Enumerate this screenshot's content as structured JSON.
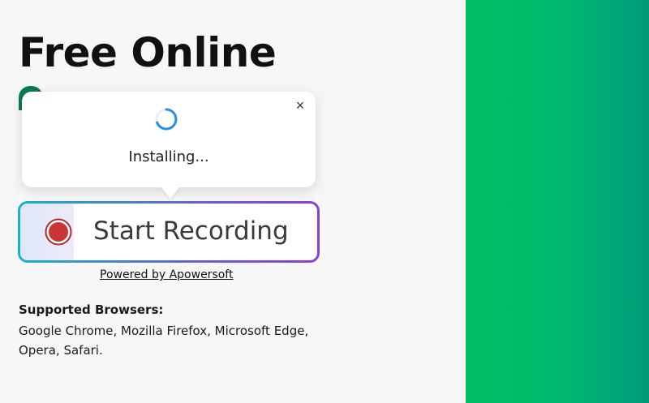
{
  "hero": {
    "title": "Free Online"
  },
  "popup": {
    "status": "Installing...",
    "close_icon": "×"
  },
  "record": {
    "label": "Start Recording"
  },
  "powered_by": "Powered by Apowersoft",
  "supported": {
    "heading": "Supported Browsers:",
    "browsers": "Google Chrome, Mozilla Firefox, Microsoft Edge, Opera, Safari."
  },
  "colors": {
    "accent_green": "#00c063",
    "record_red": "#c93434",
    "spinner_blue": "#2a8fe0"
  }
}
